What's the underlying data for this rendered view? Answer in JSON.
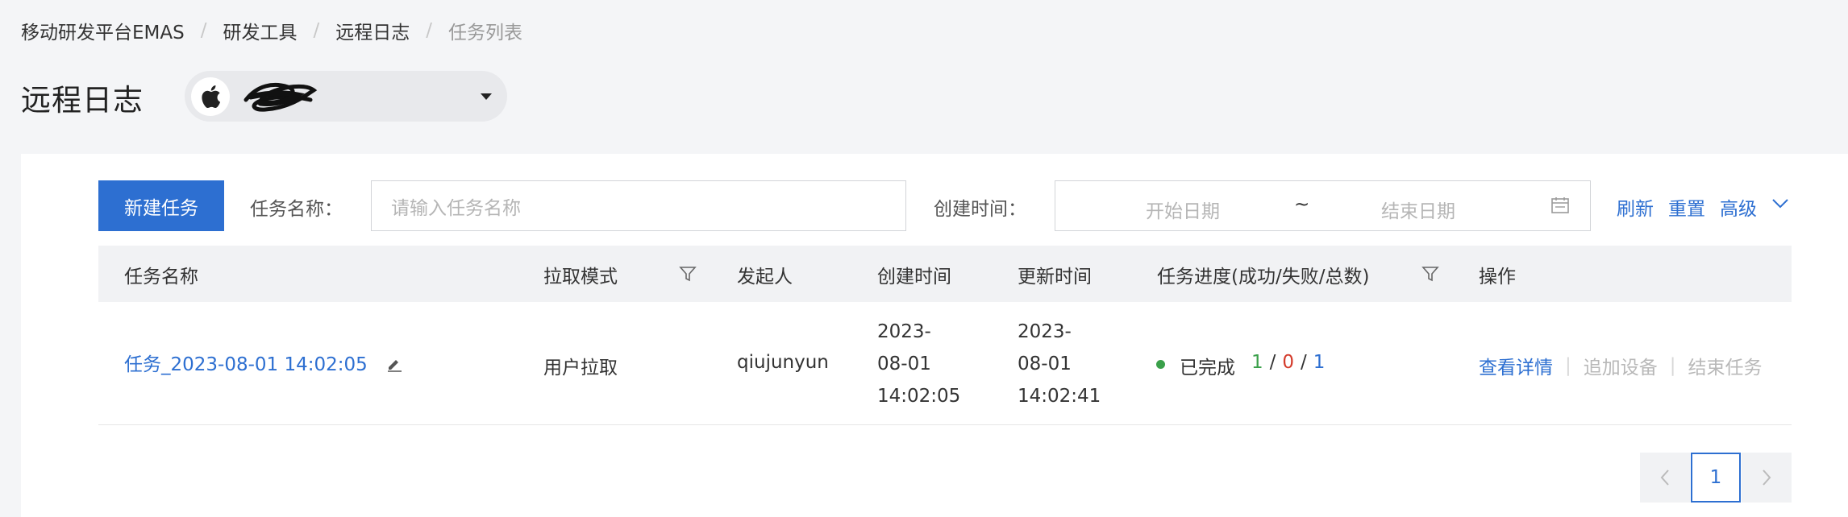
{
  "breadcrumb": [
    "移动研发平台EMAS",
    "研发工具",
    "远程日志",
    "任务列表"
  ],
  "page_title": "远程日志",
  "app_selector": {
    "icon": "apple-icon",
    "name_redacted": true
  },
  "toolbar": {
    "new_task": "新建任务",
    "task_name_label": "任务名称：",
    "task_name_placeholder": "请输入任务名称",
    "created_label": "创建时间：",
    "start_placeholder": "开始日期",
    "range_sep": "~",
    "end_placeholder": "结束日期",
    "refresh": "刷新",
    "reset": "重置",
    "advanced": "高级"
  },
  "table": {
    "columns": [
      "任务名称",
      "拉取模式",
      "发起人",
      "创建时间",
      "更新时间",
      "任务进度(成功/失败/总数)",
      "操作"
    ],
    "rows": [
      {
        "name": "任务_2023-08-01 14:02:05",
        "mode": "用户拉取",
        "initiator": "qiujunyun",
        "created": [
          "2023-",
          "08-01",
          "14:02:05"
        ],
        "updated": [
          "2023-",
          "08-01",
          "14:02:41"
        ],
        "status": "已完成",
        "success": "1",
        "fail": "0",
        "total": "1",
        "slash": "/",
        "ops": {
          "detail": "查看详情",
          "add_device": "追加设备",
          "end_task": "结束任务",
          "sep": "|"
        }
      }
    ]
  },
  "pagination": {
    "current": "1"
  },
  "colors": {
    "primary": "#2d6fd1",
    "success": "#3aa04a",
    "fail": "#d43b2b"
  }
}
